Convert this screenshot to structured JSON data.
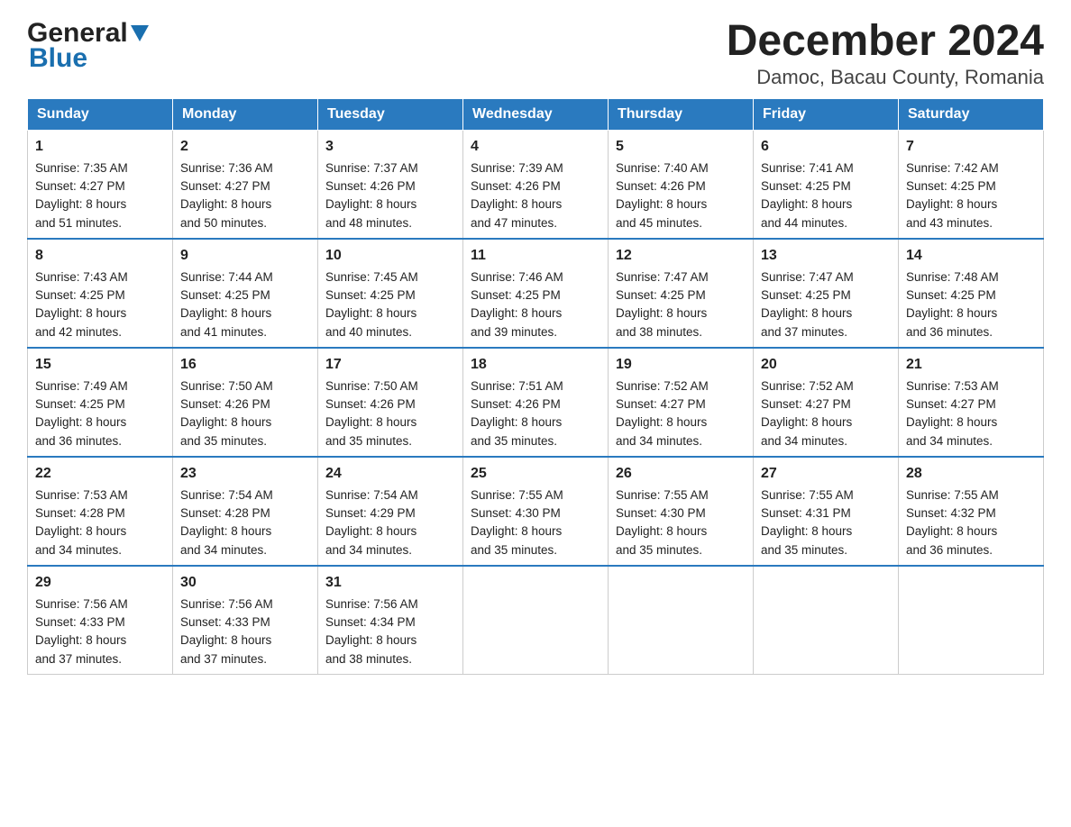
{
  "logo": {
    "general": "General",
    "blue": "Blue",
    "triangle": true
  },
  "title": "December 2024",
  "subtitle": "Damoc, Bacau County, Romania",
  "days_of_week": [
    "Sunday",
    "Monday",
    "Tuesday",
    "Wednesday",
    "Thursday",
    "Friday",
    "Saturday"
  ],
  "weeks": [
    [
      {
        "day": "1",
        "sunrise": "7:35 AM",
        "sunset": "4:27 PM",
        "daylight": "8 hours and 51 minutes."
      },
      {
        "day": "2",
        "sunrise": "7:36 AM",
        "sunset": "4:27 PM",
        "daylight": "8 hours and 50 minutes."
      },
      {
        "day": "3",
        "sunrise": "7:37 AM",
        "sunset": "4:26 PM",
        "daylight": "8 hours and 48 minutes."
      },
      {
        "day": "4",
        "sunrise": "7:39 AM",
        "sunset": "4:26 PM",
        "daylight": "8 hours and 47 minutes."
      },
      {
        "day": "5",
        "sunrise": "7:40 AM",
        "sunset": "4:26 PM",
        "daylight": "8 hours and 45 minutes."
      },
      {
        "day": "6",
        "sunrise": "7:41 AM",
        "sunset": "4:25 PM",
        "daylight": "8 hours and 44 minutes."
      },
      {
        "day": "7",
        "sunrise": "7:42 AM",
        "sunset": "4:25 PM",
        "daylight": "8 hours and 43 minutes."
      }
    ],
    [
      {
        "day": "8",
        "sunrise": "7:43 AM",
        "sunset": "4:25 PM",
        "daylight": "8 hours and 42 minutes."
      },
      {
        "day": "9",
        "sunrise": "7:44 AM",
        "sunset": "4:25 PM",
        "daylight": "8 hours and 41 minutes."
      },
      {
        "day": "10",
        "sunrise": "7:45 AM",
        "sunset": "4:25 PM",
        "daylight": "8 hours and 40 minutes."
      },
      {
        "day": "11",
        "sunrise": "7:46 AM",
        "sunset": "4:25 PM",
        "daylight": "8 hours and 39 minutes."
      },
      {
        "day": "12",
        "sunrise": "7:47 AM",
        "sunset": "4:25 PM",
        "daylight": "8 hours and 38 minutes."
      },
      {
        "day": "13",
        "sunrise": "7:47 AM",
        "sunset": "4:25 PM",
        "daylight": "8 hours and 37 minutes."
      },
      {
        "day": "14",
        "sunrise": "7:48 AM",
        "sunset": "4:25 PM",
        "daylight": "8 hours and 36 minutes."
      }
    ],
    [
      {
        "day": "15",
        "sunrise": "7:49 AM",
        "sunset": "4:25 PM",
        "daylight": "8 hours and 36 minutes."
      },
      {
        "day": "16",
        "sunrise": "7:50 AM",
        "sunset": "4:26 PM",
        "daylight": "8 hours and 35 minutes."
      },
      {
        "day": "17",
        "sunrise": "7:50 AM",
        "sunset": "4:26 PM",
        "daylight": "8 hours and 35 minutes."
      },
      {
        "day": "18",
        "sunrise": "7:51 AM",
        "sunset": "4:26 PM",
        "daylight": "8 hours and 35 minutes."
      },
      {
        "day": "19",
        "sunrise": "7:52 AM",
        "sunset": "4:27 PM",
        "daylight": "8 hours and 34 minutes."
      },
      {
        "day": "20",
        "sunrise": "7:52 AM",
        "sunset": "4:27 PM",
        "daylight": "8 hours and 34 minutes."
      },
      {
        "day": "21",
        "sunrise": "7:53 AM",
        "sunset": "4:27 PM",
        "daylight": "8 hours and 34 minutes."
      }
    ],
    [
      {
        "day": "22",
        "sunrise": "7:53 AM",
        "sunset": "4:28 PM",
        "daylight": "8 hours and 34 minutes."
      },
      {
        "day": "23",
        "sunrise": "7:54 AM",
        "sunset": "4:28 PM",
        "daylight": "8 hours and 34 minutes."
      },
      {
        "day": "24",
        "sunrise": "7:54 AM",
        "sunset": "4:29 PM",
        "daylight": "8 hours and 34 minutes."
      },
      {
        "day": "25",
        "sunrise": "7:55 AM",
        "sunset": "4:30 PM",
        "daylight": "8 hours and 35 minutes."
      },
      {
        "day": "26",
        "sunrise": "7:55 AM",
        "sunset": "4:30 PM",
        "daylight": "8 hours and 35 minutes."
      },
      {
        "day": "27",
        "sunrise": "7:55 AM",
        "sunset": "4:31 PM",
        "daylight": "8 hours and 35 minutes."
      },
      {
        "day": "28",
        "sunrise": "7:55 AM",
        "sunset": "4:32 PM",
        "daylight": "8 hours and 36 minutes."
      }
    ],
    [
      {
        "day": "29",
        "sunrise": "7:56 AM",
        "sunset": "4:33 PM",
        "daylight": "8 hours and 37 minutes."
      },
      {
        "day": "30",
        "sunrise": "7:56 AM",
        "sunset": "4:33 PM",
        "daylight": "8 hours and 37 minutes."
      },
      {
        "day": "31",
        "sunrise": "7:56 AM",
        "sunset": "4:34 PM",
        "daylight": "8 hours and 38 minutes."
      },
      null,
      null,
      null,
      null
    ]
  ],
  "labels": {
    "sunrise": "Sunrise:",
    "sunset": "Sunset:",
    "daylight": "Daylight:"
  }
}
